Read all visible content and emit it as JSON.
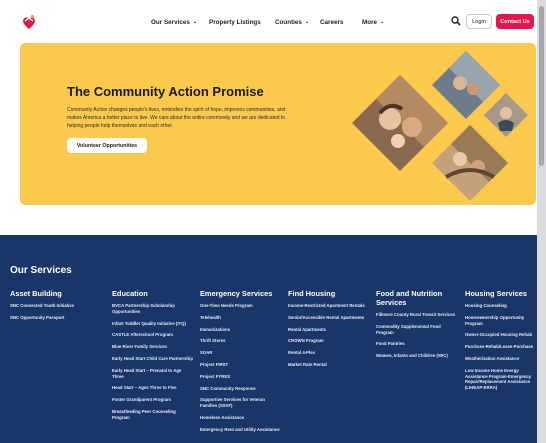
{
  "nav": {
    "logo": "logo-icon",
    "items": [
      {
        "label": "Our Services",
        "dropdown": true
      },
      {
        "label": "Property Listings",
        "dropdown": false
      },
      {
        "label": "Counties",
        "dropdown": true
      },
      {
        "label": "Careers",
        "dropdown": false
      },
      {
        "label": "More",
        "dropdown": true
      }
    ],
    "login_label": "Login",
    "contact_label": "Contact Us",
    "accent_color": "#e3154a"
  },
  "hero": {
    "title": "The Community Action Promise",
    "text": "Community Action changes people's lives, embodies the spirit of hope, improves communities, and makes America a better place to live. We care about the entire community and we are dedicated to helping people help themselves and each other.",
    "button_label": "Volunteer Opportunities",
    "background_color": "#fcc94f"
  },
  "services": {
    "title": "Our Services",
    "background_color": "#1a3669",
    "columns": [
      {
        "heading": "Asset Building",
        "items": [
          "SNC Connected Youth Initiative",
          "SNC Opportunity Passport"
        ]
      },
      {
        "heading": "Education",
        "items": [
          "BVCA Partnership Scholarship Opportunities",
          "Infant Toddler Quality Initiative (ITQ)",
          "CASTLE Afterschool Program",
          "Blue River Family Services",
          "Early Head Start Child Care Partnership",
          "Early Head Start – Prenatal to Age Three",
          "Head Start – Ages Three to Five",
          "Foster Grandparent Program",
          "Breastfeeding Peer Counseling Program"
        ]
      },
      {
        "heading": "Emergency Services",
        "items": [
          "One-Time Needs Program",
          "Telehealth",
          "Immunizations",
          "Thrift Stores",
          "SOAR",
          "Project FIRST",
          "Project FYRES",
          "SNC Community Response",
          "Supportive Services for Veteran Families (SSVF)",
          "Homeless Assistance",
          "Emergency Rent and Utility Assistance"
        ]
      },
      {
        "heading": "Find Housing",
        "items": [
          "Income-Restricted Apartment Rentals",
          "Senior/Accessible Rental Apartments",
          "Rental Apartments",
          "CROWN Program",
          "Rental 4-Plex",
          "Market Rate Rental"
        ]
      },
      {
        "heading": "Food and Nutrition Services",
        "items": [
          "Fillmore County Rural Transit Services",
          "Commodity Supplemental Food Program",
          "Food Pantries",
          "Women, Infants and Children (WIC)"
        ]
      },
      {
        "heading": "Housing Services",
        "items": [
          "Housing Counseling",
          "Homeownership Opportunity Program",
          "Owner-Occupied Housing Rehab",
          "Purchase-Rehab/Lease-Purchase",
          "Weatherization Assistance",
          "Low Income Home Energy Assistance Program-Emergency Repair/Replacement Assistance (LIHEAP-ERRA)"
        ]
      }
    ]
  }
}
